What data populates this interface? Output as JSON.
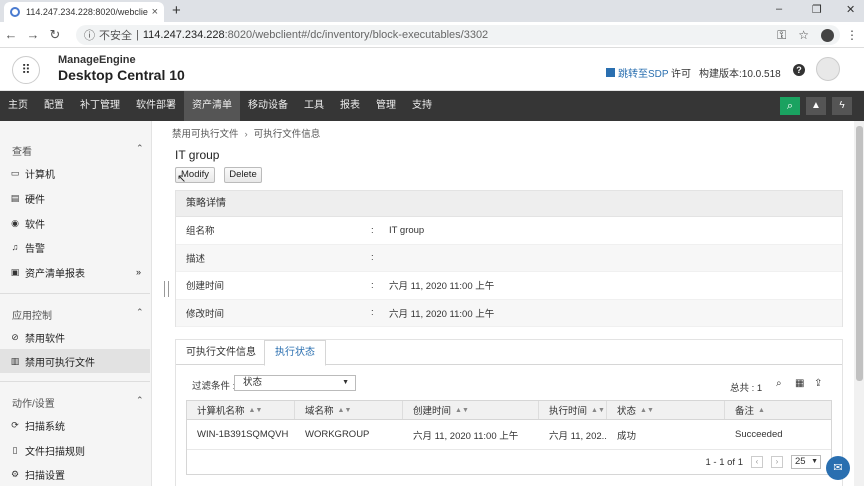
{
  "browser": {
    "tab_title": "114.247.234.228:8020/webclie",
    "tab_close": "×",
    "new_tab": "+",
    "window_controls": [
      "–",
      "❐",
      "✕"
    ],
    "security_label": "不安全",
    "url_host": "114.247.234.228",
    "url_path": ":8020/webclient#/dc/inventory/block-executables/3302"
  },
  "header": {
    "brand_top": "ManageEngine",
    "brand_bottom": "Desktop Central 10",
    "sdp_link": "跳转至SDP",
    "license": "许可",
    "build": "构建版本:10.0.518",
    "help": "?"
  },
  "nav": {
    "items": [
      "主页",
      "配置",
      "补丁管理",
      "软件部署",
      "资产清单",
      "移动设备",
      "工具",
      "报表",
      "管理",
      "支持"
    ],
    "active_index": 4
  },
  "sidebar": {
    "sections": [
      {
        "title": "查看",
        "items": [
          {
            "label": "计算机",
            "icon": "monitor-icon"
          },
          {
            "label": "硬件",
            "icon": "hardware-icon"
          },
          {
            "label": "软件",
            "icon": "software-icon"
          },
          {
            "label": "告警",
            "icon": "bell-icon"
          },
          {
            "label": "资产清单报表",
            "icon": "report-icon"
          }
        ]
      },
      {
        "title": "应用控制",
        "items": [
          {
            "label": "禁用软件",
            "icon": "block-software-icon"
          },
          {
            "label": "禁用可执行文件",
            "icon": "block-exe-icon"
          }
        ]
      },
      {
        "title": "动作/设置",
        "items": [
          {
            "label": "扫描系统",
            "icon": "scan-icon"
          },
          {
            "label": "文件扫描规则",
            "icon": "file-rule-icon"
          },
          {
            "label": "扫描设置",
            "icon": "settings-icon"
          }
        ]
      }
    ],
    "selected": "禁用可执行文件"
  },
  "content": {
    "breadcrumb": [
      "禁用可执行文件",
      "可执行文件信息"
    ],
    "title": "IT group",
    "modify_button": "Modify",
    "delete_button": "Delete",
    "panel_title": "策略详情",
    "details": [
      {
        "key": "组名称",
        "value": "IT group"
      },
      {
        "key": "描述",
        "value": ""
      },
      {
        "key": "创建时间",
        "value": "六月 11, 2020 11:00 上午"
      },
      {
        "key": "修改时间",
        "value": "六月 11, 2020 11:00 上午"
      }
    ],
    "colon": ":",
    "tabs": [
      "可执行文件信息",
      "执行状态"
    ],
    "active_tab": 1,
    "filter_label": "过滤条件 :",
    "filter_value": "状态",
    "total": "总共 : 1",
    "columns": [
      "计算机名称",
      "域名称",
      "创建时间",
      "执行时间",
      "状态",
      "备注"
    ],
    "rows": [
      [
        "WIN-1B391SQMQVH",
        "WORKGROUP",
        "六月 11, 2020 11:00 上午",
        "六月 11, 202...",
        "成功",
        "Succeeded"
      ]
    ],
    "pager": "1 - 1 of 1",
    "per_page": "25"
  }
}
